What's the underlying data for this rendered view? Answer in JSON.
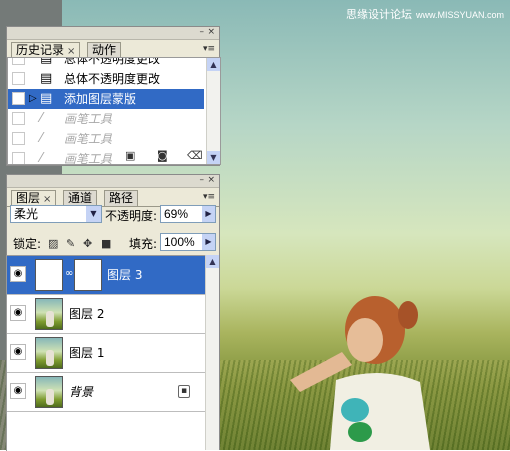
{
  "watermark": {
    "text": "思缘设计论坛",
    "url": "www.MISSYUAN.com"
  },
  "history_panel": {
    "tabs": [
      {
        "label": "历史记录",
        "close": "×"
      },
      {
        "label": "动作"
      }
    ],
    "menu_glyph": "▾≡",
    "title_buttons": {
      "minimize": "–",
      "close": "×"
    },
    "items": [
      {
        "label": "总体不透明度更改",
        "state": "normal",
        "icon": "history-state-icon"
      },
      {
        "label": "总体不透明度更改",
        "state": "normal",
        "icon": "history-state-icon"
      },
      {
        "label": "添加图层蒙版",
        "state": "selected",
        "icon": "history-state-icon"
      },
      {
        "label": "画笔工具",
        "state": "dimmed",
        "icon": "brush-icon"
      },
      {
        "label": "画笔工具",
        "state": "dimmed",
        "icon": "brush-icon"
      },
      {
        "label": "画笔工具",
        "state": "dimmed",
        "icon": "brush-icon"
      }
    ],
    "footer_icons": [
      "new-document-icon",
      "camera-snapshot-icon",
      "trash-icon"
    ]
  },
  "layers_panel": {
    "tabs": [
      {
        "label": "图层",
        "close": "×"
      },
      {
        "label": "通道"
      },
      {
        "label": "路径"
      }
    ],
    "menu_glyph": "▾≡",
    "title_buttons": {
      "minimize": "–",
      "close": "×"
    },
    "blend_mode": "柔光",
    "opacity_label": "不透明度:",
    "opacity_value": "69%",
    "lock_label": "锁定:",
    "fill_label": "填充:",
    "fill_value": "100%",
    "layers": [
      {
        "name": "图层 3",
        "selected": true,
        "has_mask": true,
        "italic": false,
        "locked": false
      },
      {
        "name": "图层 2",
        "selected": false,
        "has_mask": false,
        "italic": false,
        "locked": false
      },
      {
        "name": "图层 1",
        "selected": false,
        "has_mask": false,
        "italic": false,
        "locked": false
      },
      {
        "name": "背景",
        "selected": false,
        "has_mask": false,
        "italic": true,
        "locked": true
      }
    ]
  },
  "colors": {
    "selection": "#316ac5",
    "panel_bg": "#ece9d8",
    "scroll_arrow": "#c5d3f5"
  }
}
